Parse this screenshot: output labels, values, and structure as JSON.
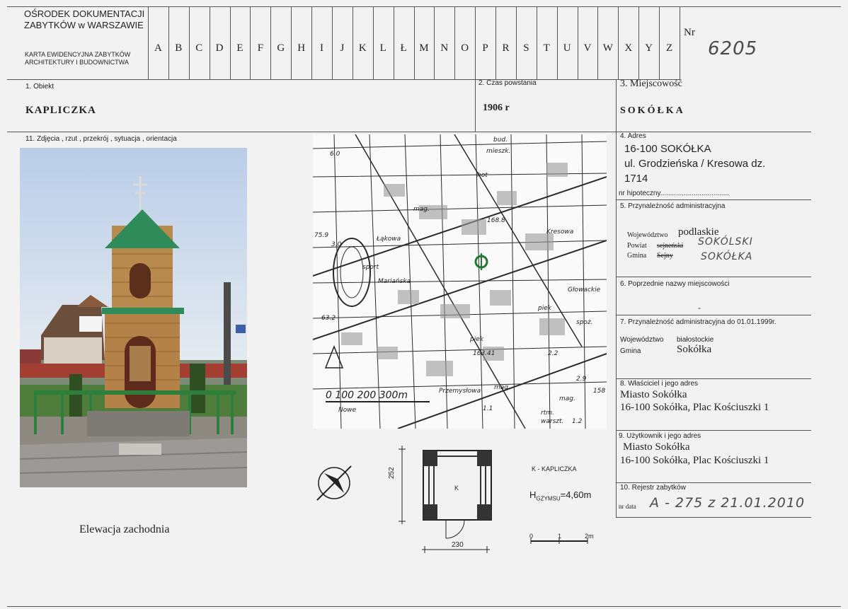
{
  "header": {
    "institution_line1": "OŚRODEK DOKUMENTACJI",
    "institution_line2": "ZABYTKÓW w WARSZAWIE",
    "card_title_line1": "KARTA EWIDENCYJNA ZABYTKÓW",
    "card_title_line2": "ARCHITEKTURY I BUDOWNICTWA",
    "alphabet": [
      "A",
      "B",
      "C",
      "D",
      "E",
      "F",
      "G",
      "H",
      "I",
      "J",
      "K",
      "L",
      "Ł",
      "M",
      "N",
      "O",
      "P",
      "R",
      "S",
      "T",
      "U",
      "V",
      "W",
      "X",
      "Y",
      "Z"
    ],
    "nr_label": "Nr",
    "nr_value": "6205"
  },
  "fields": {
    "obiekt_label": "1. Obiekt",
    "obiekt_value": "KAPLICZKA",
    "czas_label": "2. Czas powstania",
    "czas_value": "1906 r",
    "miejscowosc_label": "3. Miejscowość",
    "miejscowosc_value": "SOKÓŁKA",
    "zdjecia_label": "11. Zdjęcia , rzut , przekrój , sytuacja , orientacja",
    "adres_label": "4. Adres",
    "adres_line1": "16-100 SOKÓŁKA",
    "adres_line2": "ul. Grodzieńska / Kresowa dz.",
    "adres_line3": "1714",
    "hipoteczny": "nr hipoteczny...................................",
    "przynaleznosc_label": "5.    Przynależność administracyjna",
    "woj_label": "Województwo",
    "woj_value": "podlaskie",
    "powiat_label": "Powiat",
    "powiat_struck": "sejneński",
    "powiat_hand": "SOKÓLSKI",
    "gmina_label": "Gmina",
    "gmina_struck": "Sejny",
    "gmina_hand": "SOKÓŁKA",
    "poprzednie_label": "6.  Poprzednie nazwy miejscowości",
    "poprzednie_value": "-",
    "przyn99_label": "7.     Przynależność administracyjna do 01.01.1999r.",
    "woj99_label": "Województwo",
    "woj99_value": "białostockie",
    "gmina99_label": "Gmina",
    "gmina99_value": "Sokółka",
    "wlasciciel_label": "8.     Właściciel i jego adres",
    "wlasciciel_line1": "Miasto Sokółka",
    "wlasciciel_line2": "16-100 Sokółka, Plac Kościuszki 1",
    "uzytkownik_label": "9. Użytkownik i jego adres",
    "uzytkownik_line1": "Miasto Sokółka",
    "uzytkownik_line2": "16-100 Sokółka, Plac Kościuszki 1",
    "rejestr_label": "10. Rejestr zabytków",
    "nr_data_label": "nr data",
    "rejestr_hand": "A - 275   z   21.01.2010"
  },
  "photo_caption": "Elewacja zachodnia",
  "plan": {
    "legend": "K  -  KAPLICZKA",
    "height_prefix": "H",
    "height_sub": "GZYMSU",
    "height_value": "=4,60m",
    "dim_vertical": "252",
    "dim_horizontal": "230",
    "room_label": "K",
    "scale_0": "0",
    "scale_1": "1",
    "scale_2": "2m"
  },
  "map": {
    "labels": [
      "bud.",
      "mieszk.",
      "hot",
      "mag.",
      "168.8",
      "Kresowa",
      "Łąkowa",
      "Mariańska",
      "sport",
      "75.9",
      "3.0",
      "Głowackie",
      "piek",
      "spoż.",
      "piek",
      "163.41",
      "2.2",
      "Przemysłowa",
      "mag.",
      "2.9",
      "158",
      "mag.",
      "1.1",
      "rtm.",
      "warszt.",
      "1.2",
      "Nowe",
      "6.0",
      "63.2"
    ],
    "scale_hand": "0   100   200   300m"
  },
  "colors": {
    "border": "#555555",
    "roof": "#2f8c5a",
    "brick": "#b98a4e"
  }
}
